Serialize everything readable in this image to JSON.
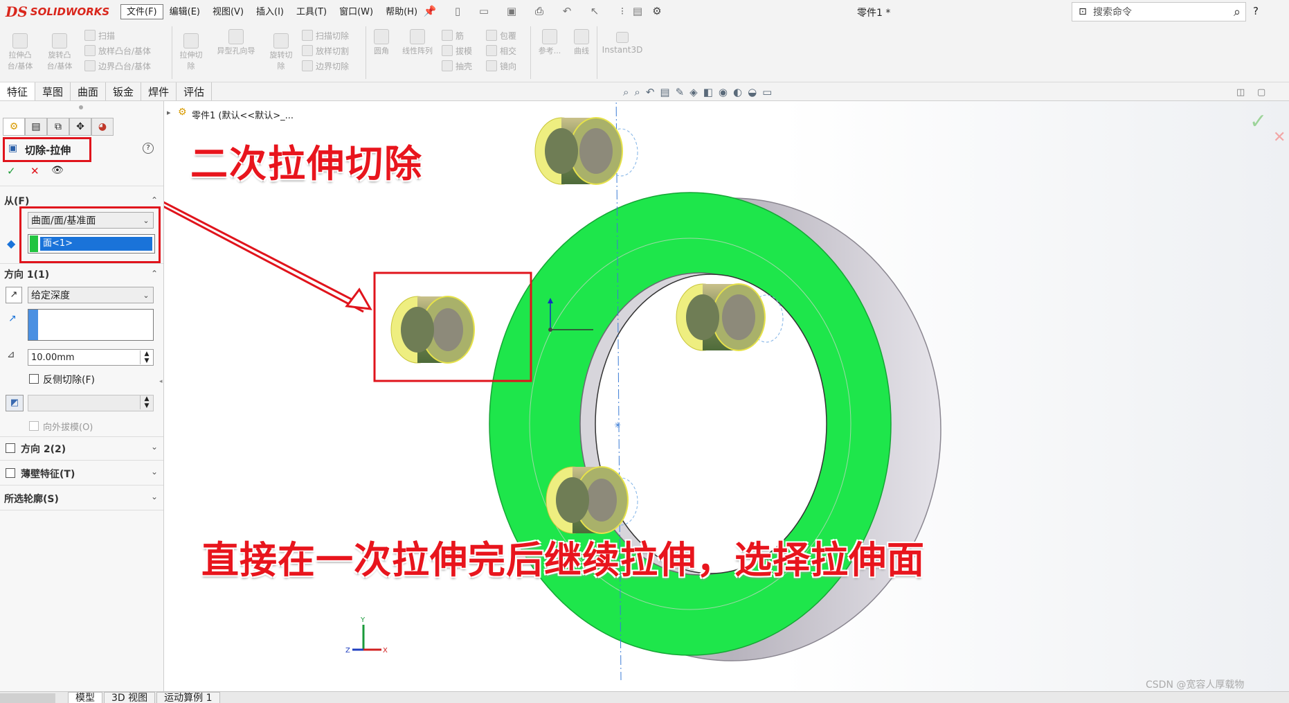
{
  "app": {
    "logo_mark": "DS",
    "logo_text": "SOLIDWORKS",
    "document_title": "零件1 *"
  },
  "menu": [
    "文件(F)",
    "编辑(E)",
    "视图(V)",
    "插入(I)",
    "工具(T)",
    "窗口(W)",
    "帮助(H)"
  ],
  "search": {
    "placeholder": "搜索命令"
  },
  "help_label": "?",
  "command_manager": {
    "extrude_boss": "拉伸凸\n台/基体",
    "revolve_boss": "旋转凸\n台/基体",
    "sweep": "扫描",
    "loft_boss": "放样凸台/基体",
    "boundary_boss": "边界凸台/基体",
    "extrude_cut": "拉伸切\n除",
    "hole_wizard": "异型孔向导",
    "revolve_cut": "旋转切\n除",
    "swept_cut": "扫描切除",
    "lofted_cut": "放样切割",
    "boundary_cut": "边界切除",
    "fillet": "圆角",
    "linear_pattern": "线性阵列",
    "rib": "筋",
    "draft": "拔模",
    "shell": "抽壳",
    "wrap": "包覆",
    "intersect": "相交",
    "mirror": "镜向",
    "reference": "参考...",
    "curves": "曲线",
    "instant3d": "Instant3D"
  },
  "tabs": [
    "特征",
    "草图",
    "曲面",
    "钣金",
    "焊件",
    "评估"
  ],
  "active_tab": "特征",
  "tree_breadcrumb": "零件1  (默认<<默认>_...",
  "property_manager": {
    "title": "切除-拉伸",
    "from": {
      "label": "从(F)",
      "type": "曲面/面/基准面",
      "selection": "面<1>"
    },
    "direction1": {
      "label": "方向 1(1)",
      "end_condition": "给定深度",
      "depth": "10.00mm",
      "flip_side_label": "反侧切除(F)",
      "draft_outward_label": "向外拔模(O)"
    },
    "direction2": {
      "label": "方向 2(2)"
    },
    "thin_feature": {
      "label": "薄壁特征(T)"
    },
    "selected_contours": {
      "label": "所选轮廓(S)"
    }
  },
  "annotations": {
    "title": "二次拉伸切除",
    "caption": "直接在一次拉伸完后继续拉伸，选择拉伸面",
    "color": "#e8151d"
  },
  "bottom_tabs": [
    "模型",
    "3D 视图",
    "运动算例 1"
  ],
  "watermark": "CSDN @宽容人厚载物",
  "triad": {
    "x": "X",
    "y": "Y",
    "z": "Z"
  },
  "colors": {
    "face_green": "#1ee64b",
    "hole_yellow": "#f2f05a",
    "accent_red": "#e0141c",
    "selection_blue": "#1a73d9"
  }
}
